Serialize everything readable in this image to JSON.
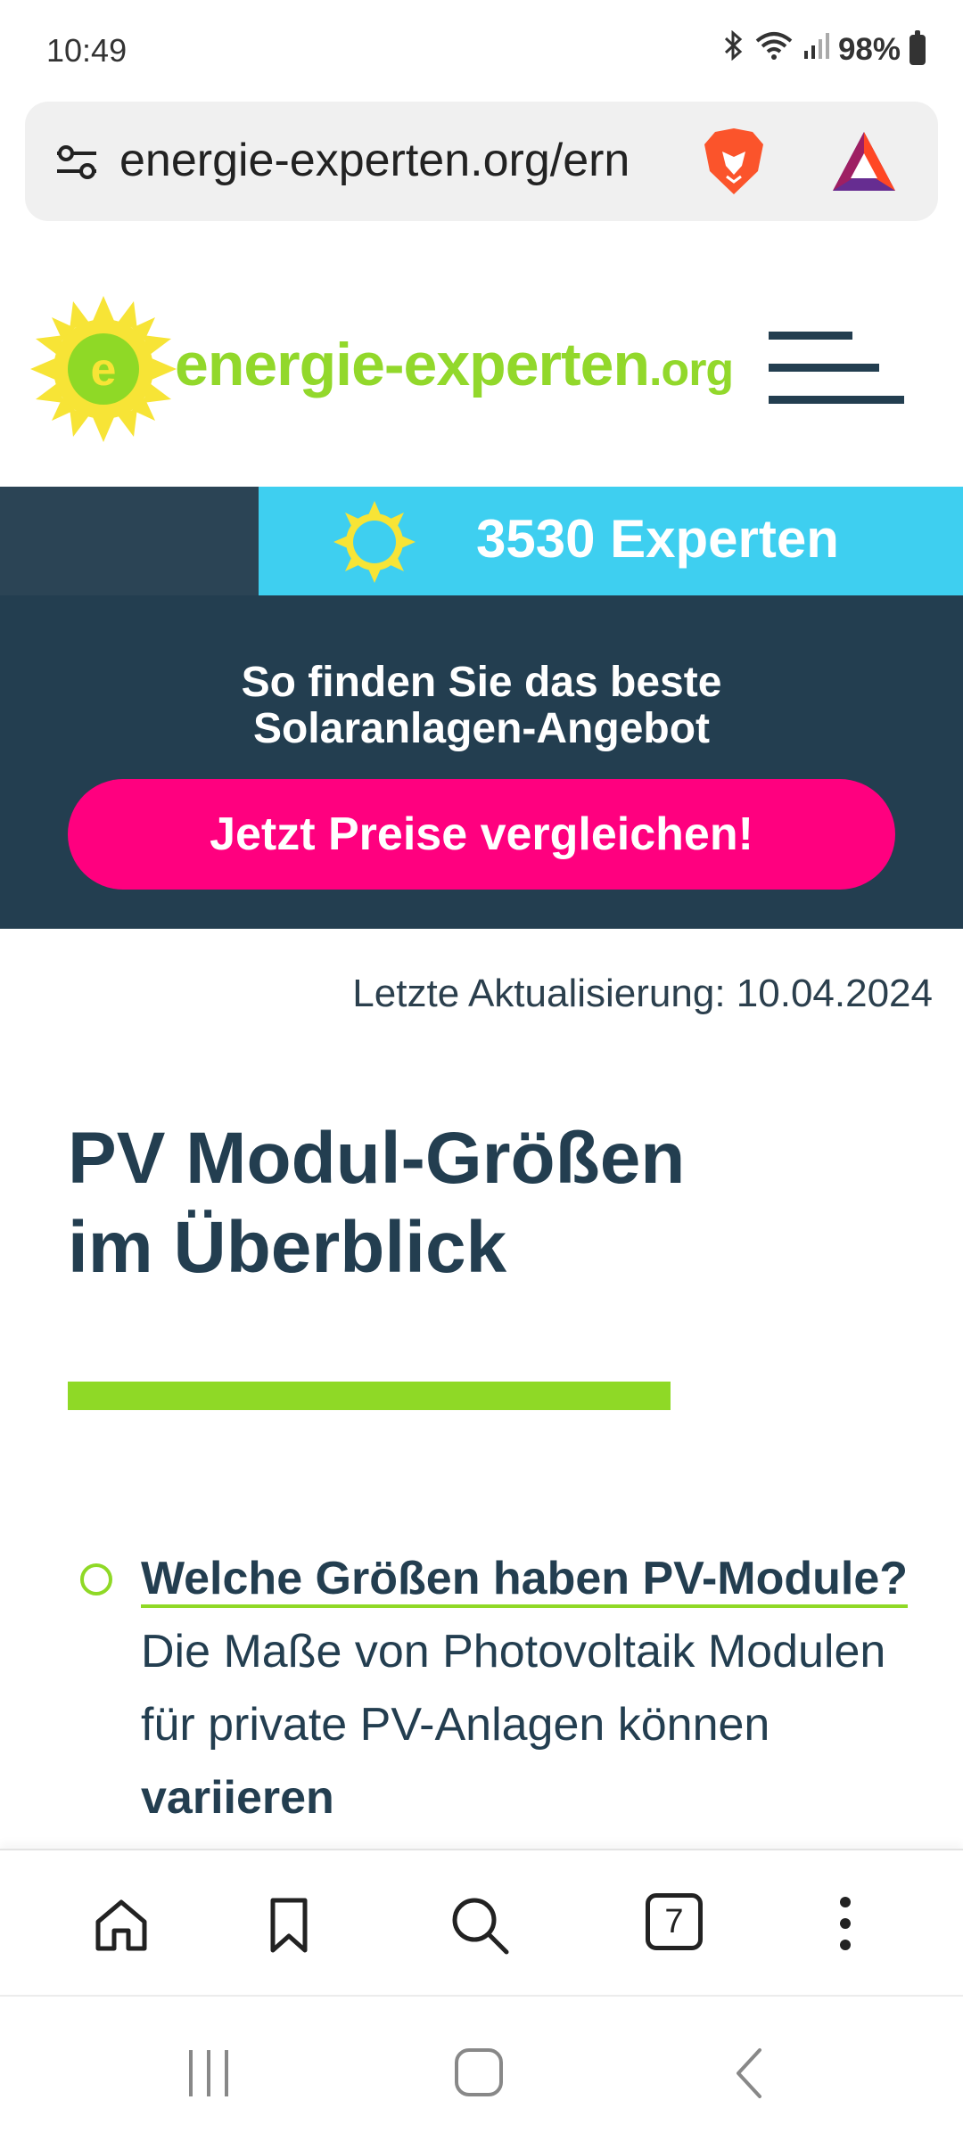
{
  "status": {
    "time": "10:49",
    "battery": "98%"
  },
  "browser": {
    "url": "energie-experten.org/ern"
  },
  "site": {
    "logo_text_main": "energie-experten",
    "logo_text_org": ".org"
  },
  "banner": {
    "experts": "3530 Experten"
  },
  "promo": {
    "title_line1": "So finden Sie das beste",
    "title_line2": "Solaranlagen-Angebot",
    "cta": "Jetzt Preise vergleichen!"
  },
  "article": {
    "updated": "Letzte Aktualisierung: 10.04.2024",
    "title_line1": "PV Modul-Größen",
    "title_line2": "im Überblick",
    "bullet_question": "Welche Größen haben PV-Module?",
    "bullet_text1": " Die Maße von Photovoltaik Modulen für private PV-Anlagen können ",
    "bullet_bold": "variieren"
  },
  "toolbar": {
    "tab_count": "7"
  },
  "colors": {
    "accent_green": "#8fd926",
    "navy": "#233e50",
    "pink": "#ff007f",
    "cyan": "#3ecff0"
  }
}
